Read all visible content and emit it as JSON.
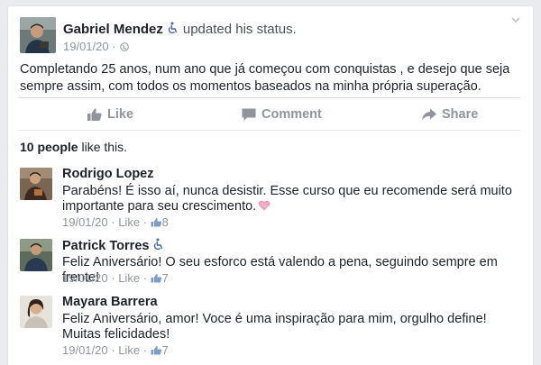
{
  "post": {
    "author": "Gabriel Mendez",
    "action": "updated his status.",
    "date": "19/01/20",
    "dot": "·",
    "text": "Completando 25 anos, num ano que já começou com conquistas , e desejo que seja sempre assim, com todos os momentos baseados na minha própria superação."
  },
  "actions": {
    "like": "Like",
    "comment": "Comment",
    "share": "Share"
  },
  "likes": {
    "count_text": "10 people",
    "suffix": " like this."
  },
  "comments": [
    {
      "name": "Rodrigo Lopez",
      "text": "Parabéns! É isso aí, nunca desistir. Esse curso que eu recomende será muito importante para seu crescimento.",
      "date": "19/01/20",
      "like_label": "Like",
      "sep": "·",
      "likes": "8"
    },
    {
      "name": "Patrick Torres",
      "text": "Feliz Aniversário! O seu esforco está valendo a pena, seguindo sempre em frente!",
      "date": "19/01/20",
      "like_label": "Like",
      "sep": "·",
      "likes": "7"
    },
    {
      "name": "Mayara Barrera",
      "text": "Feliz Aniversário, amor! Voce é uma inspiração para mim,  orgulho define! Muitas felicidades!",
      "date": "19/01/20",
      "like_label": "Like",
      "sep": "·",
      "likes": "7"
    }
  ],
  "colors": {
    "accent": "#4267b2",
    "muted": "#90949c",
    "text": "#1d2129"
  },
  "icons": [
    "chevron-down-icon",
    "accessibility-icon",
    "globe-icon",
    "like-thumb-icon",
    "comment-bubble-icon",
    "share-arrow-icon",
    "heart-emoji-icon"
  ]
}
